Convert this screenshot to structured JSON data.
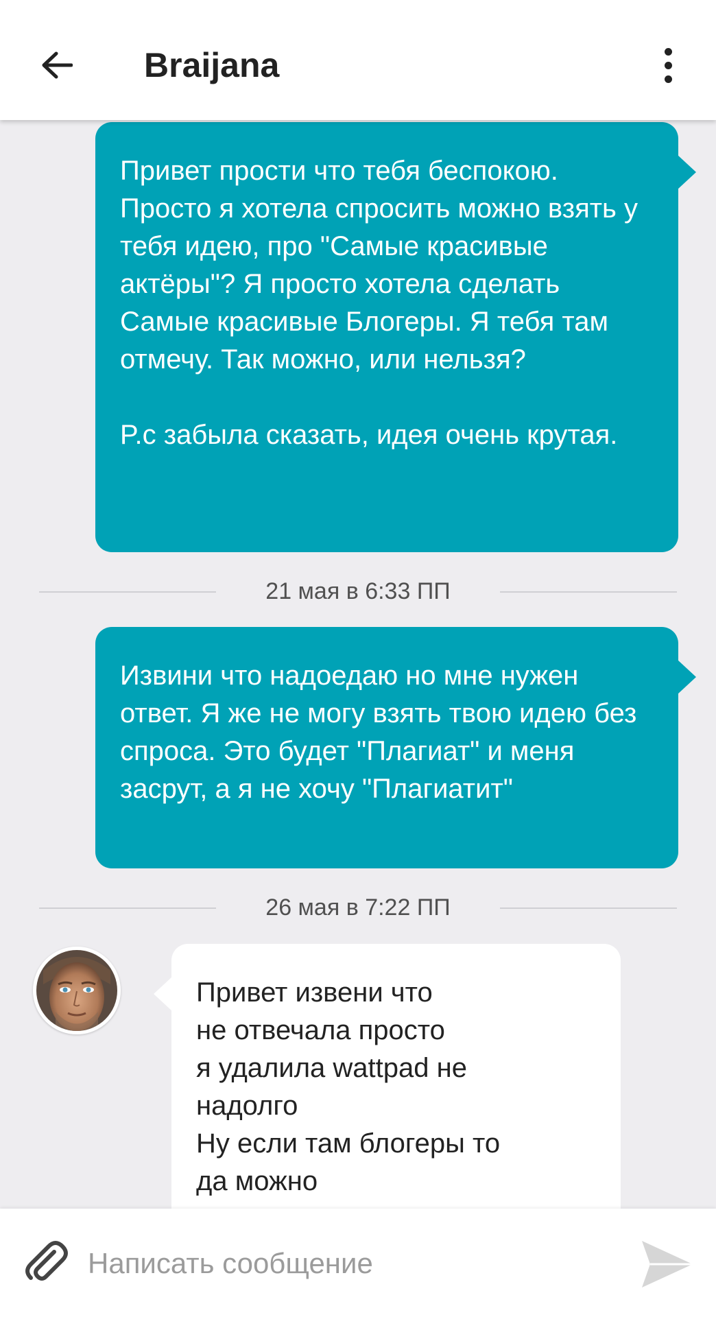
{
  "header": {
    "title": "Braijana",
    "back_icon": "arrow-left-icon",
    "menu_icon": "more-vertical-icon"
  },
  "messages": [
    {
      "direction": "outgoing",
      "text": "Привет прости что тебя беспокою. Просто я хотела спросить можно взять у тебя идею, про \"Самые красивые актёры\"? Я просто хотела сделать Самые красивые Блогеры. Я тебя там отмечу. Так можно, или нельзя?\n\nP.с забыла сказать, идея очень крутая."
    },
    {
      "direction": "outgoing",
      "text": "Извини что надоедаю но мне нужен ответ. Я же не могу взять твою идею без спроса. Это будет \"Плагиат\" и меня засрут, а я не хочу \"Плагиатит\""
    },
    {
      "direction": "incoming",
      "text": "Привет извени что\nне отвечала просто\nя удалила wattpad не\nнадолго\nНу если там блогеры то\nда можно"
    }
  ],
  "date_separators": [
    "21 мая в 6:33 ПП",
    "26 мая в 7:22 ПП"
  ],
  "composer": {
    "placeholder": "Написать сообщение",
    "attach_icon": "paperclip-icon",
    "send_icon": "send-icon"
  },
  "colors": {
    "outgoing_bubble": "#00a2b6",
    "incoming_bubble": "#ffffff",
    "background": "#eeedf0"
  }
}
